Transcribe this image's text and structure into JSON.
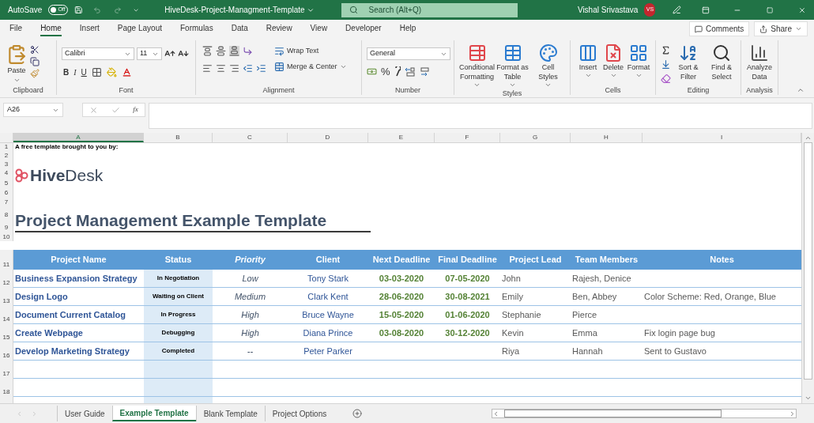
{
  "title_bar": {
    "autosave_label": "AutoSave",
    "autosave": {
      "on": false,
      "label": "Off"
    },
    "file_name": "HiveDesk-Project-Managment-Template",
    "search": {
      "placeholder": "Search (Alt+Q)"
    },
    "user_name": "Vishal Srivastava",
    "avatar_initials": "VS"
  },
  "menu_tabs": [
    {
      "label": "File",
      "selected": false
    },
    {
      "label": "Home",
      "selected": true
    },
    {
      "label": "Insert",
      "selected": false
    },
    {
      "label": "Page Layout",
      "selected": false
    },
    {
      "label": "Formulas",
      "selected": false
    },
    {
      "label": "Data",
      "selected": false
    },
    {
      "label": "Review",
      "selected": false
    },
    {
      "label": "View",
      "selected": false
    },
    {
      "label": "Developer",
      "selected": false
    },
    {
      "label": "Help",
      "selected": false
    }
  ],
  "comments_button": "Comments",
  "share_button": "Share",
  "ribbon": {
    "groups": [
      {
        "kind": "clipboard",
        "label": "Clipboard",
        "paste": "Paste"
      },
      {
        "kind": "font",
        "label": "Font",
        "font_name": "Calibri",
        "font_size": "11",
        "styles": [
          "B",
          "I",
          "U"
        ]
      },
      {
        "kind": "alignment",
        "label": "Alignment",
        "wrap_text": "Wrap Text",
        "merge": "Merge & Center"
      },
      {
        "kind": "number",
        "label": "Number",
        "format": "General",
        "percent": "%"
      },
      {
        "kind": "styles",
        "label": "Styles",
        "items": [
          "Conditional Formatting",
          "Format as Table",
          "Cell Styles"
        ]
      },
      {
        "kind": "cells",
        "label": "Cells",
        "items": [
          "Insert",
          "Delete",
          "Format"
        ]
      },
      {
        "kind": "editing",
        "label": "Editing",
        "items": [
          "Sort & Filter",
          "Find & Select"
        ]
      },
      {
        "kind": "analysis",
        "label": "Analysis",
        "items": [
          "Analyze Data"
        ]
      }
    ]
  },
  "formula_bar": {
    "name_box": "A26",
    "fx": "fx"
  },
  "sheet": {
    "columns": [
      {
        "label": "A",
        "selected": true
      },
      {
        "label": "B",
        "selected": false
      },
      {
        "label": "C",
        "selected": false
      },
      {
        "label": "D",
        "selected": false
      },
      {
        "label": "E",
        "selected": false
      },
      {
        "label": "F",
        "selected": false
      },
      {
        "label": "G",
        "selected": false
      },
      {
        "label": "H",
        "selected": false
      },
      {
        "label": "I",
        "selected": false
      }
    ],
    "row_numbers": [
      "1",
      "2",
      "3",
      "4",
      "5",
      "6",
      "7",
      "8",
      "9",
      "10",
      "11",
      "12",
      "13",
      "14",
      "15",
      "16",
      "17",
      "18"
    ],
    "intro_text": "A free template brought to you by:",
    "logo": {
      "bold": "Hive",
      "light": "Desk"
    },
    "title": "Project Management Example Template"
  },
  "table": {
    "columns": [
      {
        "label": "Project Name",
        "italic": false
      },
      {
        "label": "Status",
        "italic": false
      },
      {
        "label": "Priority",
        "italic": true
      },
      {
        "label": "Client",
        "italic": false
      },
      {
        "label": "Next Deadline",
        "italic": false
      },
      {
        "label": "Final Deadline",
        "italic": false
      },
      {
        "label": "Project Lead",
        "italic": false
      },
      {
        "label": "Team Members",
        "italic": false
      },
      {
        "label": "Notes",
        "italic": false
      }
    ],
    "rows": [
      [
        "Business Expansion Strategy",
        "In Negotiation",
        "Low",
        "Tony Stark",
        "03-03-2020",
        "07-05-2020",
        "John",
        "Rajesh, Denice",
        null
      ],
      [
        "Design Logo",
        "Waiting on Client",
        "Medium",
        "Clark Kent",
        "28-06-2020",
        "30-08-2021",
        "Emily",
        "Ben, Abbey",
        "Color Scheme: Red, Orange, Blue"
      ],
      [
        "Document Current Catalog",
        "In Progress",
        "High",
        "Bruce Wayne",
        "15-05-2020",
        "01-06-2020",
        "Stephanie",
        "Pierce",
        null
      ],
      [
        "Create Webpage",
        "Debugging",
        "High",
        "Diana Prince",
        "03-08-2020",
        "30-12-2020",
        "Kevin",
        "Emma",
        "Fix login page bug"
      ],
      [
        "Develop Marketing Strategy",
        "Completed",
        "--",
        "Peter Parker",
        null,
        null,
        "Riya",
        "Hannah",
        "Sent to Gustavo"
      ]
    ]
  },
  "sheet_tabs": [
    {
      "label": "User Guide",
      "selected": false
    },
    {
      "label": "Example Template",
      "selected": true
    },
    {
      "label": "Blank Template",
      "selected": false
    },
    {
      "label": "Project Options",
      "selected": false
    }
  ]
}
